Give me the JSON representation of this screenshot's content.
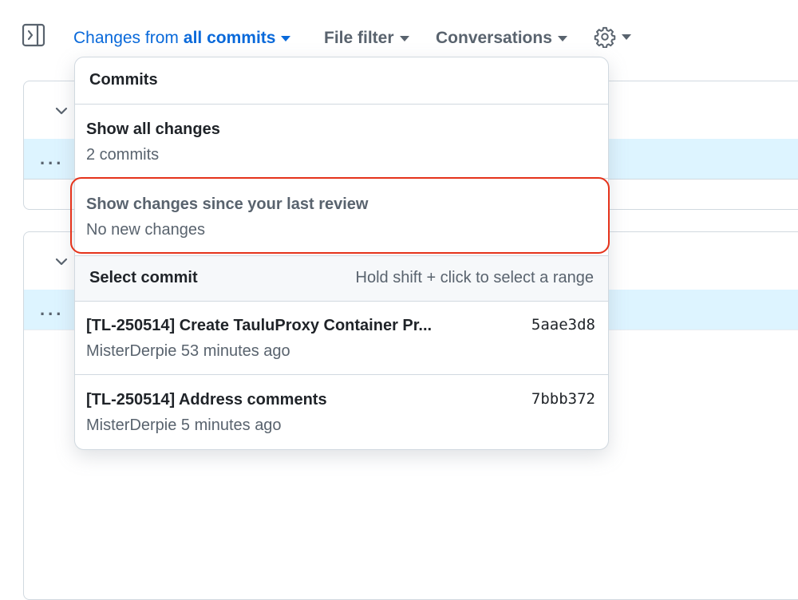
{
  "toolbar": {
    "changes_from_prefix": "Changes from",
    "changes_from_value": "all commits",
    "file_filter_label": "File filter",
    "conversations_label": "Conversations",
    "settings_icon": "gear-icon",
    "sidebar_toggle_icon": "sidebar-expand-icon"
  },
  "file_cards": [
    {
      "collapse_icon": "chevron-down-icon",
      "expand_label": "..."
    },
    {
      "collapse_icon": "chevron-down-icon",
      "expand_label": "..."
    }
  ],
  "dropdown": {
    "header": "Commits",
    "options": [
      {
        "title": "Show all changes",
        "subtitle": "2 commits"
      },
      {
        "title": "Show changes since your last review",
        "subtitle": "No new changes"
      }
    ],
    "select_commit": {
      "title": "Select commit",
      "hint": "Hold shift + click to select a range"
    },
    "commits": [
      {
        "message": "[TL-250514] Create TauluProxy Container Pr...",
        "sha": "5aae3d8",
        "author": "MisterDerpie",
        "time": "53 minutes ago"
      },
      {
        "message": "[TL-250514] Address comments",
        "sha": "7bbb372",
        "author": "MisterDerpie",
        "time": "5 minutes ago"
      }
    ]
  },
  "colors": {
    "link_blue": "#0969da",
    "muted_gray": "#59636e",
    "hunk_blue": "#ddf4ff",
    "highlight_red": "#e5331b"
  }
}
